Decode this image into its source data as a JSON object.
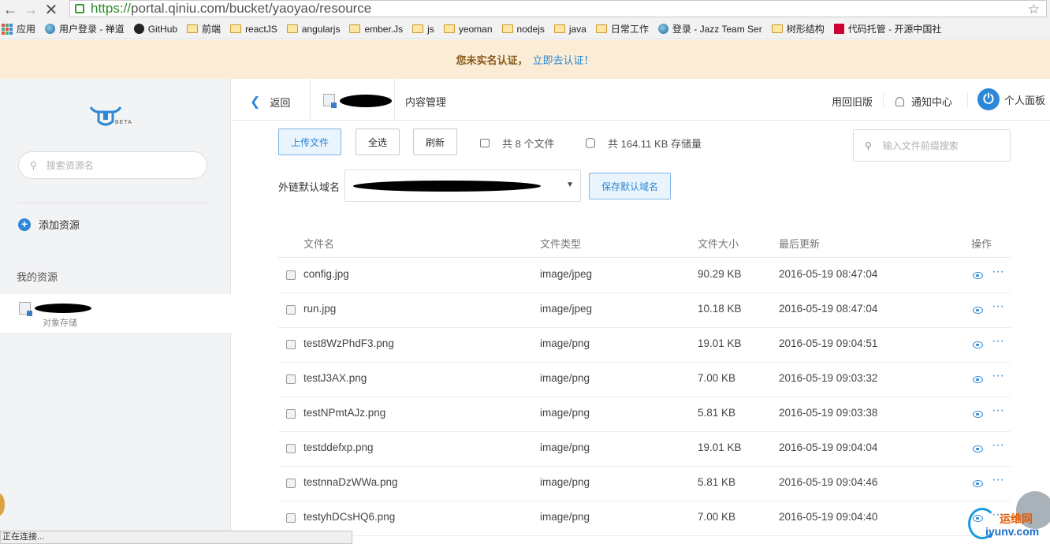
{
  "browser": {
    "url_secure": "https://",
    "url_host": "portal.qiniu.com",
    "url_path": "/bucket/yaoyao/resource",
    "bookmarks": [
      {
        "label": "应用",
        "icon": "apps-icon"
      },
      {
        "label": "用户登录 - 禅道",
        "icon": "globe-icon"
      },
      {
        "label": "GitHub",
        "icon": "github-icon"
      },
      {
        "label": "前端",
        "icon": "folder-icon"
      },
      {
        "label": "reactJS",
        "icon": "folder-icon"
      },
      {
        "label": "angularjs",
        "icon": "folder-icon"
      },
      {
        "label": "ember.Js",
        "icon": "folder-icon"
      },
      {
        "label": "js",
        "icon": "folder-icon"
      },
      {
        "label": "yeoman",
        "icon": "folder-icon"
      },
      {
        "label": "nodejs",
        "icon": "folder-icon"
      },
      {
        "label": "java",
        "icon": "folder-icon"
      },
      {
        "label": "日常工作",
        "icon": "folder-icon"
      },
      {
        "label": "登录 - Jazz Team Ser",
        "icon": "globe-icon"
      },
      {
        "label": "树形结构",
        "icon": "folder-icon"
      },
      {
        "label": "代码托管 - 开源中国社",
        "icon": "code-icon"
      }
    ],
    "status_text": "正在连接..."
  },
  "notice": {
    "text": "您未实名认证，",
    "link": "立即去认证！"
  },
  "sidebar": {
    "logo_sub": "BETA",
    "search_placeholder": "搜索资源名",
    "add_resource": "添加资源",
    "my_resources": "我的资源",
    "bucket_type": "对象存储"
  },
  "topbar": {
    "back": "返回",
    "title": "内容管理",
    "old_version": "用回旧版",
    "notifications": "通知中心",
    "profile": "个人面板"
  },
  "toolbar": {
    "upload": "上传文件",
    "select_all": "全选",
    "refresh": "刷新",
    "file_count": "共 8 个文件",
    "storage": "共 164.11 KB 存储量",
    "search_placeholder": "输入文件前缀搜索"
  },
  "domain": {
    "label": "外链默认域名",
    "save": "保存默认域名"
  },
  "table": {
    "headers": {
      "name": "文件名",
      "type": "文件类型",
      "size": "文件大小",
      "updated": "最后更新",
      "actions": "操作"
    },
    "rows": [
      {
        "name": "config.jpg",
        "type": "image/jpeg",
        "size": "90.29 KB",
        "updated": "2016-05-19 08:47:04"
      },
      {
        "name": "run.jpg",
        "type": "image/jpeg",
        "size": "10.18 KB",
        "updated": "2016-05-19 08:47:04"
      },
      {
        "name": "test8WzPhdF3.png",
        "type": "image/png",
        "size": "19.01 KB",
        "updated": "2016-05-19 09:04:51"
      },
      {
        "name": "testJ3AX.png",
        "type": "image/png",
        "size": "7.00 KB",
        "updated": "2016-05-19 09:03:32"
      },
      {
        "name": "testNPmtAJz.png",
        "type": "image/png",
        "size": "5.81 KB",
        "updated": "2016-05-19 09:03:38"
      },
      {
        "name": "testddefxp.png",
        "type": "image/png",
        "size": "19.01 KB",
        "updated": "2016-05-19 09:04:04"
      },
      {
        "name": "testnnaDzWWa.png",
        "type": "image/png",
        "size": "5.81 KB",
        "updated": "2016-05-19 09:04:46"
      },
      {
        "name": "testyhDCsHQ6.png",
        "type": "image/png",
        "size": "7.00 KB",
        "updated": "2016-05-19 09:04:40"
      }
    ]
  },
  "watermark": {
    "cn": "运维网",
    "en": "iyunv.com"
  },
  "colors": {
    "accent": "#2b88d8",
    "notice_bg": "#fbecd6",
    "sidebar_bg": "#f2f3f5"
  }
}
